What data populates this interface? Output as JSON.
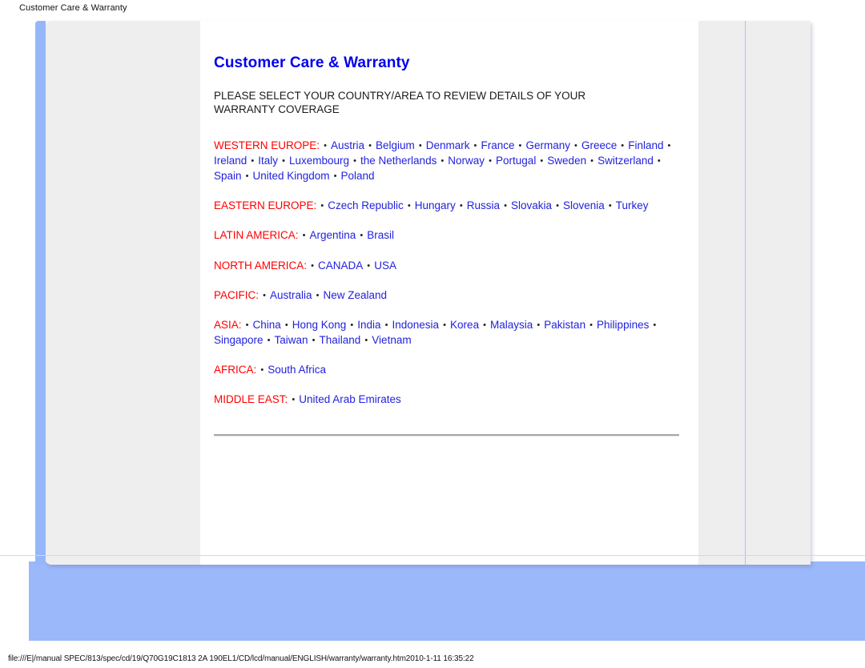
{
  "browser": {
    "title": "Customer Care & Warranty",
    "status_url": "file:///E|/manual SPEC/813/spec/cd/19/Q70G19C1813 2A 190EL1/CD/lcd/manual/ENGLISH/warranty/warranty.htm",
    "status_timestamp": "2010-1-11 16:35:22"
  },
  "colors": {
    "title_blue": "#0000ee",
    "link_blue": "#2222dd",
    "region_red": "#ff0000",
    "panel_blue": "#9ab8fa",
    "card_gray": "#eeeeee",
    "divider_gray": "#a8a8a8"
  },
  "document": {
    "title": "Customer Care & Warranty",
    "intro": "PLEASE SELECT YOUR COUNTRY/AREA TO REVIEW DETAILS OF YOUR WARRANTY COVERAGE",
    "separator": "•",
    "regions": [
      {
        "label": "WESTERN EUROPE:",
        "countries": [
          "Austria",
          "Belgium",
          "Denmark",
          "France",
          "Germany",
          "Greece",
          "Finland",
          "Ireland",
          "Italy",
          "Luxembourg",
          "the Netherlands",
          "Norway",
          "Portugal",
          "Sweden",
          "Switzerland",
          "Spain",
          "United Kingdom",
          "Poland"
        ]
      },
      {
        "label": "EASTERN EUROPE:",
        "countries": [
          "Czech Republic",
          "Hungary",
          "Russia",
          "Slovakia",
          "Slovenia",
          "Turkey"
        ]
      },
      {
        "label": "LATIN AMERICA:",
        "countries": [
          "Argentina",
          "Brasil"
        ]
      },
      {
        "label": "NORTH AMERICA:",
        "countries": [
          "CANADA",
          "USA"
        ]
      },
      {
        "label": "PACIFIC:",
        "countries": [
          "Australia",
          "New Zealand"
        ]
      },
      {
        "label": "ASIA:",
        "countries": [
          "China",
          "Hong Kong",
          "India",
          "Indonesia",
          "Korea",
          "Malaysia",
          "Pakistan",
          "Philippines",
          "Singapore",
          "Taiwan",
          "Thailand",
          "Vietnam"
        ]
      },
      {
        "label": "AFRICA:",
        "countries": [
          "South Africa"
        ]
      },
      {
        "label": "MIDDLE EAST:",
        "countries": [
          "United Arab Emirates"
        ]
      }
    ]
  }
}
